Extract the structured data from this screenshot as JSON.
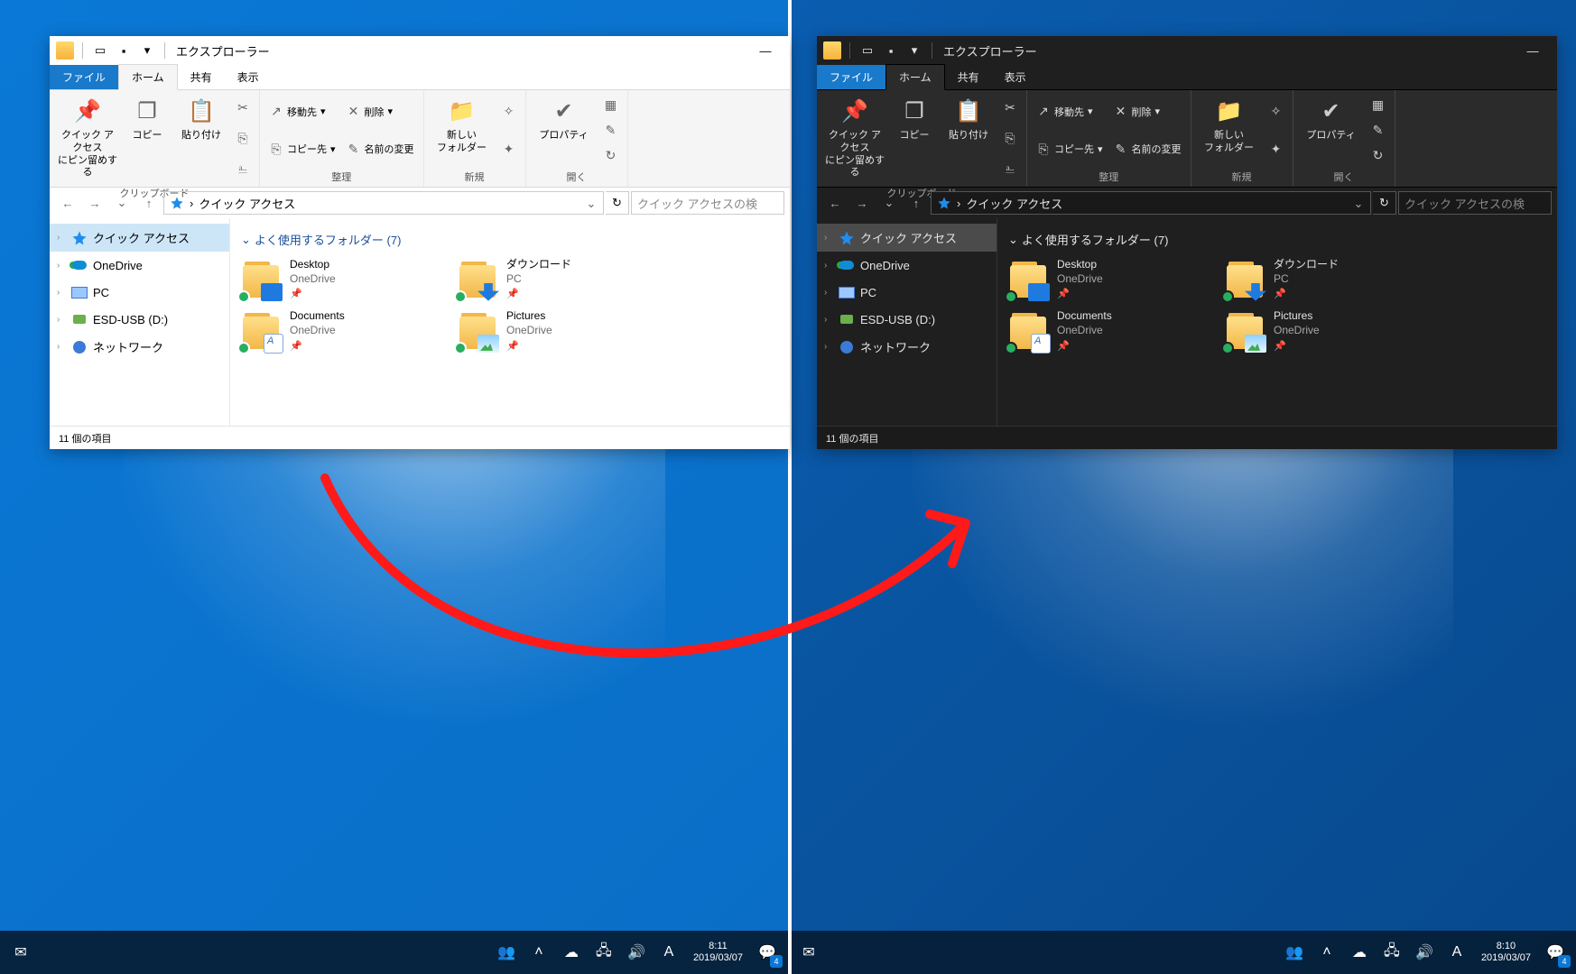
{
  "window": {
    "title": "エクスプローラー",
    "tabs": {
      "file": "ファイル",
      "home": "ホーム",
      "share": "共有",
      "view": "表示"
    },
    "ribbon": {
      "pin": "クイック アクセス\nにピン留めする",
      "copy": "コピー",
      "paste": "貼り付け",
      "moveTo": "移動先",
      "copyTo": "コピー先",
      "delete": "削除",
      "rename": "名前の変更",
      "newFolder": "新しい\nフォルダー",
      "properties": "プロパティ",
      "grp_clipboard": "クリップボード",
      "grp_organize": "整理",
      "grp_new": "新規",
      "grp_open": "開く"
    },
    "address": {
      "root": "クイック アクセス",
      "search_ph": "クイック アクセスの検"
    },
    "nav": [
      {
        "label": "クイック アクセス",
        "icon": "star",
        "sel": true
      },
      {
        "label": "OneDrive",
        "icon": "onedrive",
        "sel": false
      },
      {
        "label": "PC",
        "icon": "pc",
        "sel": false
      },
      {
        "label": "ESD-USB (D:)",
        "icon": "usb",
        "sel": false
      },
      {
        "label": "ネットワーク",
        "icon": "net",
        "sel": false
      }
    ],
    "group_header": "よく使用するフォルダー (7)",
    "folders": [
      {
        "name": "Desktop",
        "loc": "OneDrive",
        "ov": "desktop"
      },
      {
        "name": "ダウンロード",
        "loc": "PC",
        "ov": "dl"
      },
      {
        "name": "Documents",
        "loc": "OneDrive",
        "ov": "doc"
      },
      {
        "name": "Pictures",
        "loc": "OneDrive",
        "ov": "pic"
      }
    ],
    "status": "11 個の項目"
  },
  "taskbar": {
    "clock_left": {
      "time": "8:11",
      "date": "2019/03/07"
    },
    "clock_right": {
      "time": "8:10",
      "date": "2019/03/07"
    },
    "badge": "4"
  }
}
